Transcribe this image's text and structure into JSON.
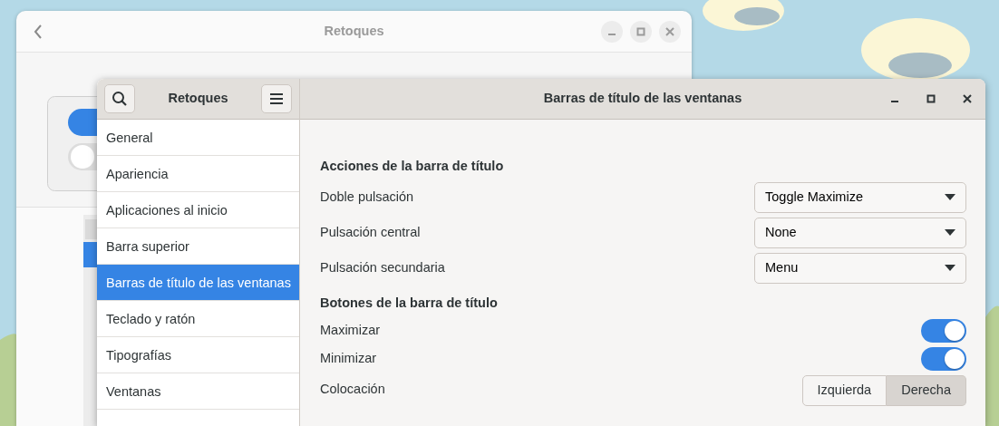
{
  "back_window": {
    "title": "Retoques"
  },
  "window": {
    "sidebar_title": "Retoques",
    "title": "Barras de título de las ventanas"
  },
  "sidebar": {
    "items": [
      {
        "label": "General",
        "selected": false
      },
      {
        "label": "Apariencia",
        "selected": false
      },
      {
        "label": "Aplicaciones al inicio",
        "selected": false
      },
      {
        "label": "Barra superior",
        "selected": false
      },
      {
        "label": "Barras de título de las ventanas",
        "selected": true
      },
      {
        "label": "Teclado y ratón",
        "selected": false
      },
      {
        "label": "Tipografías",
        "selected": false
      },
      {
        "label": "Ventanas",
        "selected": false
      }
    ]
  },
  "sections": [
    {
      "heading": "Acciones de la barra de título",
      "rows": [
        {
          "kind": "dropdown",
          "label": "Doble pulsación",
          "value": "Toggle Maximize"
        },
        {
          "kind": "dropdown",
          "label": "Pulsación central",
          "value": "None"
        },
        {
          "kind": "dropdown",
          "label": "Pulsación secundaria",
          "value": "Menu"
        }
      ]
    },
    {
      "heading": "Botones de la barra de título",
      "rows": [
        {
          "kind": "switch",
          "label": "Maximizar",
          "on": true
        },
        {
          "kind": "switch",
          "label": "Minimizar",
          "on": true
        },
        {
          "kind": "segmented",
          "label": "Colocación",
          "options": [
            {
              "label": "Izquierda",
              "selected": false
            },
            {
              "label": "Derecha",
              "selected": true
            }
          ]
        }
      ]
    }
  ]
}
